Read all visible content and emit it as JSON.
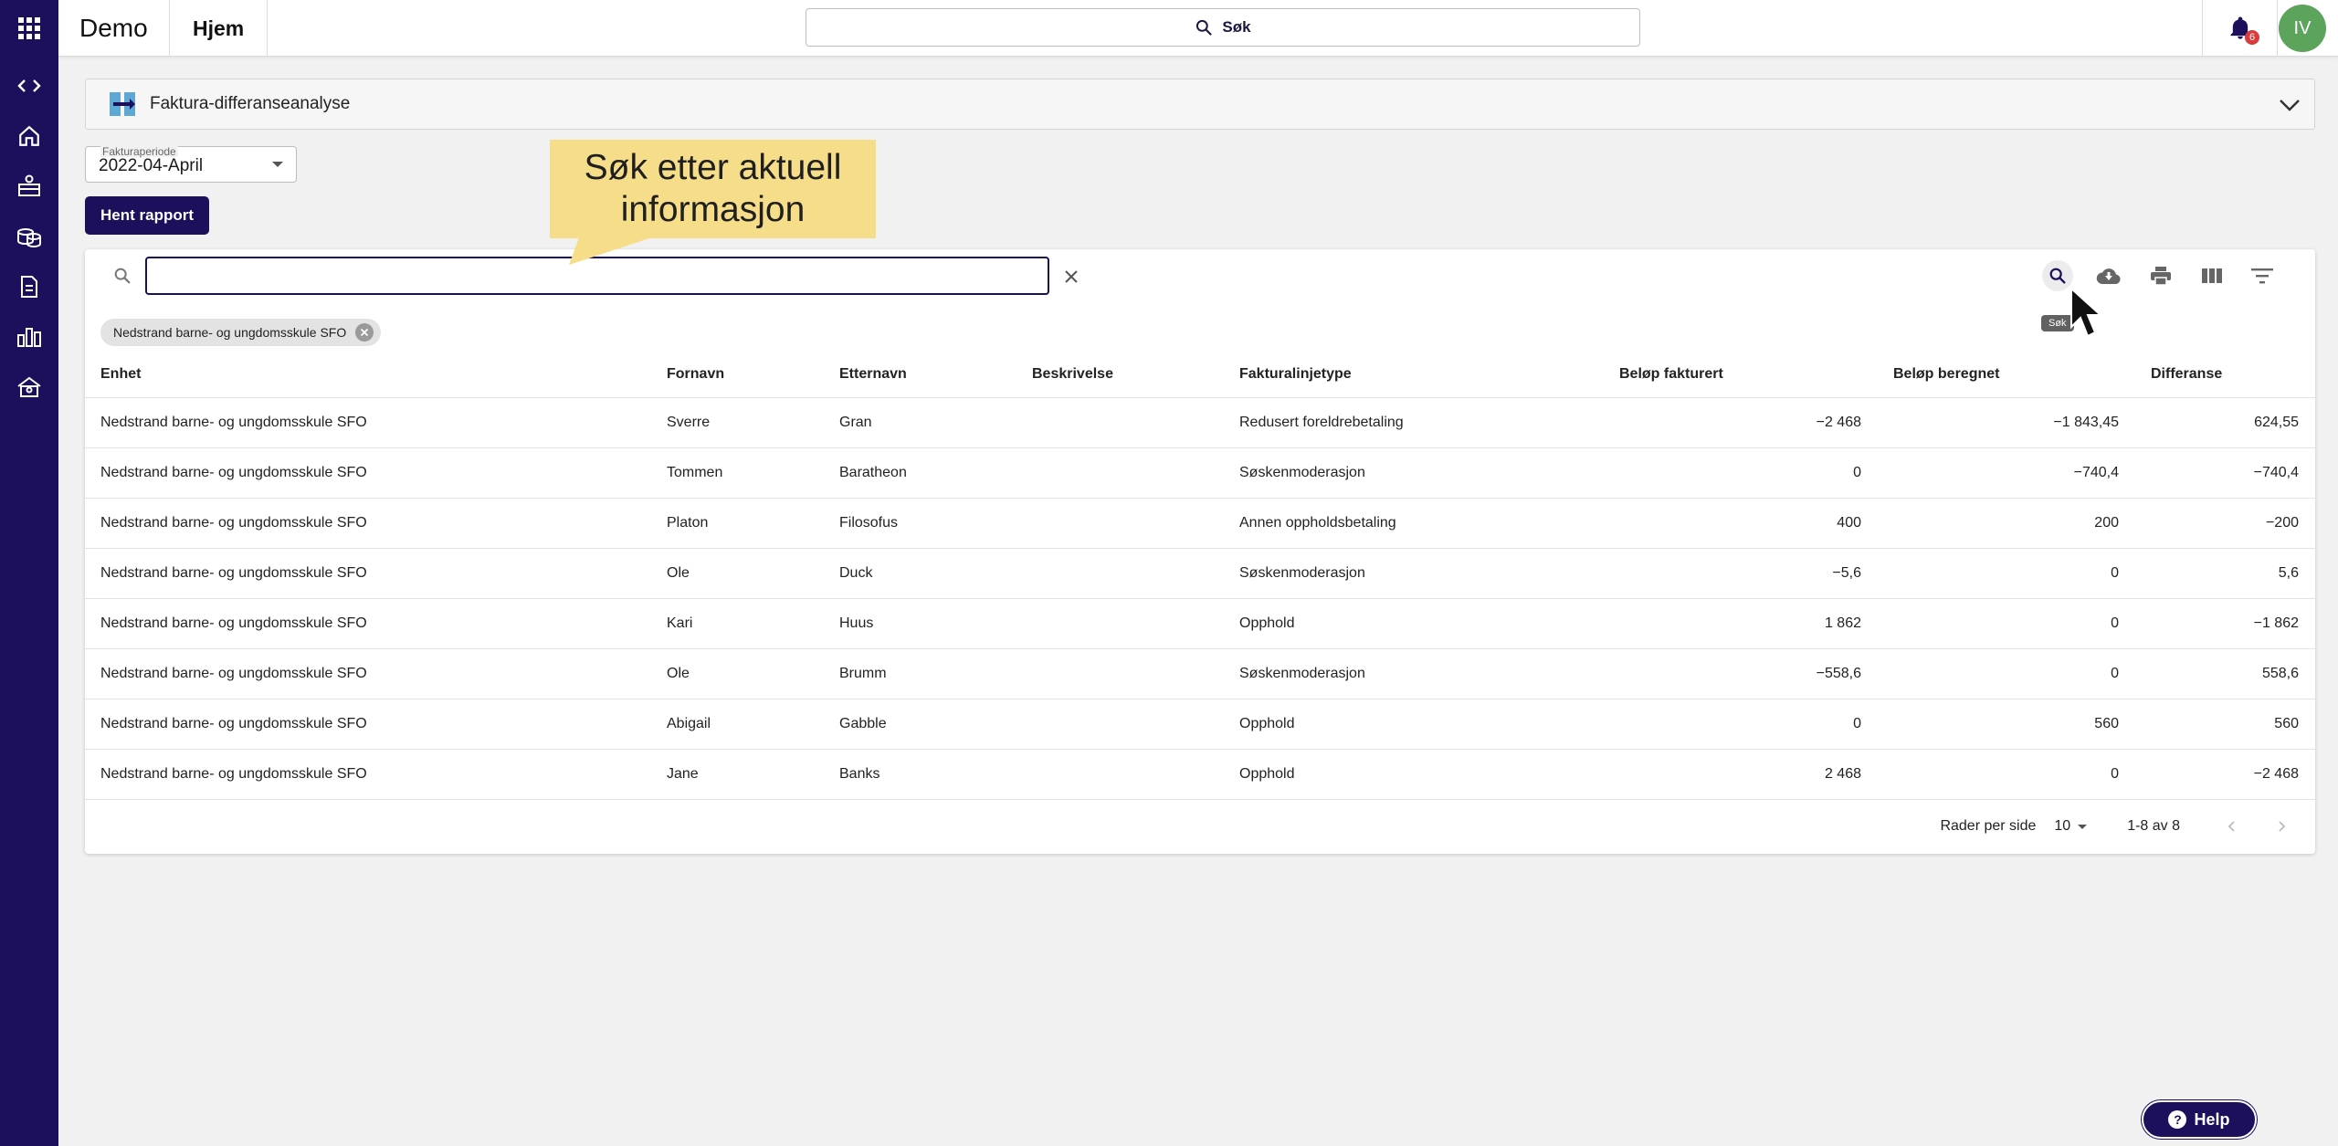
{
  "app": {
    "brand": "Demo",
    "breadcrumb": "Hjem",
    "search_label": "Søk",
    "notifications_count": "6",
    "avatar_initials": "IV"
  },
  "report": {
    "title": "Faktura-differanseanalyse",
    "period_label": "Fakturaperiode",
    "period_value": "2022-04-April",
    "fetch_label": "Hent rapport"
  },
  "callout": {
    "text": "Søk etter aktuell informasjon"
  },
  "table": {
    "search_value": "",
    "tooltip": "Søk",
    "filter_chip": "Nedstrand barne- og ungdomsskule SFO",
    "columns": [
      "Enhet",
      "Fornavn",
      "Etternavn",
      "Beskrivelse",
      "Fakturalinjetype",
      "Beløp fakturert",
      "Beløp beregnet",
      "Differanse"
    ],
    "rows": [
      [
        "Nedstrand barne- og ungdomsskule SFO",
        "Sverre",
        "Gran",
        "",
        "Redusert foreldrebetaling",
        "−2 468",
        "−1 843,45",
        "624,55"
      ],
      [
        "Nedstrand barne- og ungdomsskule SFO",
        "Tommen",
        "Baratheon",
        "",
        "Søskenmoderasjon",
        "0",
        "−740,4",
        "−740,4"
      ],
      [
        "Nedstrand barne- og ungdomsskule SFO",
        "Platon",
        "Filosofus",
        "",
        "Annen oppholdsbetaling",
        "400",
        "200",
        "−200"
      ],
      [
        "Nedstrand barne- og ungdomsskule SFO",
        "Ole",
        "Duck",
        "",
        "Søskenmoderasjon",
        "−5,6",
        "0",
        "5,6"
      ],
      [
        "Nedstrand barne- og ungdomsskule SFO",
        "Kari",
        "Huus",
        "",
        "Opphold",
        "1 862",
        "0",
        "−1 862"
      ],
      [
        "Nedstrand barne- og ungdomsskule SFO",
        "Ole",
        "Brumm",
        "",
        "Søskenmoderasjon",
        "−558,6",
        "0",
        "558,6"
      ],
      [
        "Nedstrand barne- og ungdomsskule SFO",
        "Abigail",
        "Gabble",
        "",
        "Opphold",
        "0",
        "560",
        "560"
      ],
      [
        "Nedstrand barne- og ungdomsskule SFO",
        "Jane",
        "Banks",
        "",
        "Opphold",
        "2 468",
        "0",
        "−2 468"
      ]
    ],
    "pagination": {
      "rows_per_page_label": "Rader per side",
      "rows_per_page": "10",
      "range": "1-8 av 8"
    }
  },
  "help": {
    "label": "Help"
  },
  "colors": {
    "brand_navy": "#1c0f5c",
    "callout_yellow": "#f5dd8a",
    "avatar_green": "#5ca35c",
    "badge_red": "#d93a3a"
  },
  "icons": {
    "rail": [
      "code-icon",
      "home-icon",
      "child-care-icon",
      "coins-icon",
      "document-icon",
      "bar-chart-icon",
      "organization-icon"
    ],
    "toolbar": [
      "search-icon",
      "cloud-download-icon",
      "print-icon",
      "columns-icon",
      "filter-icon"
    ]
  }
}
